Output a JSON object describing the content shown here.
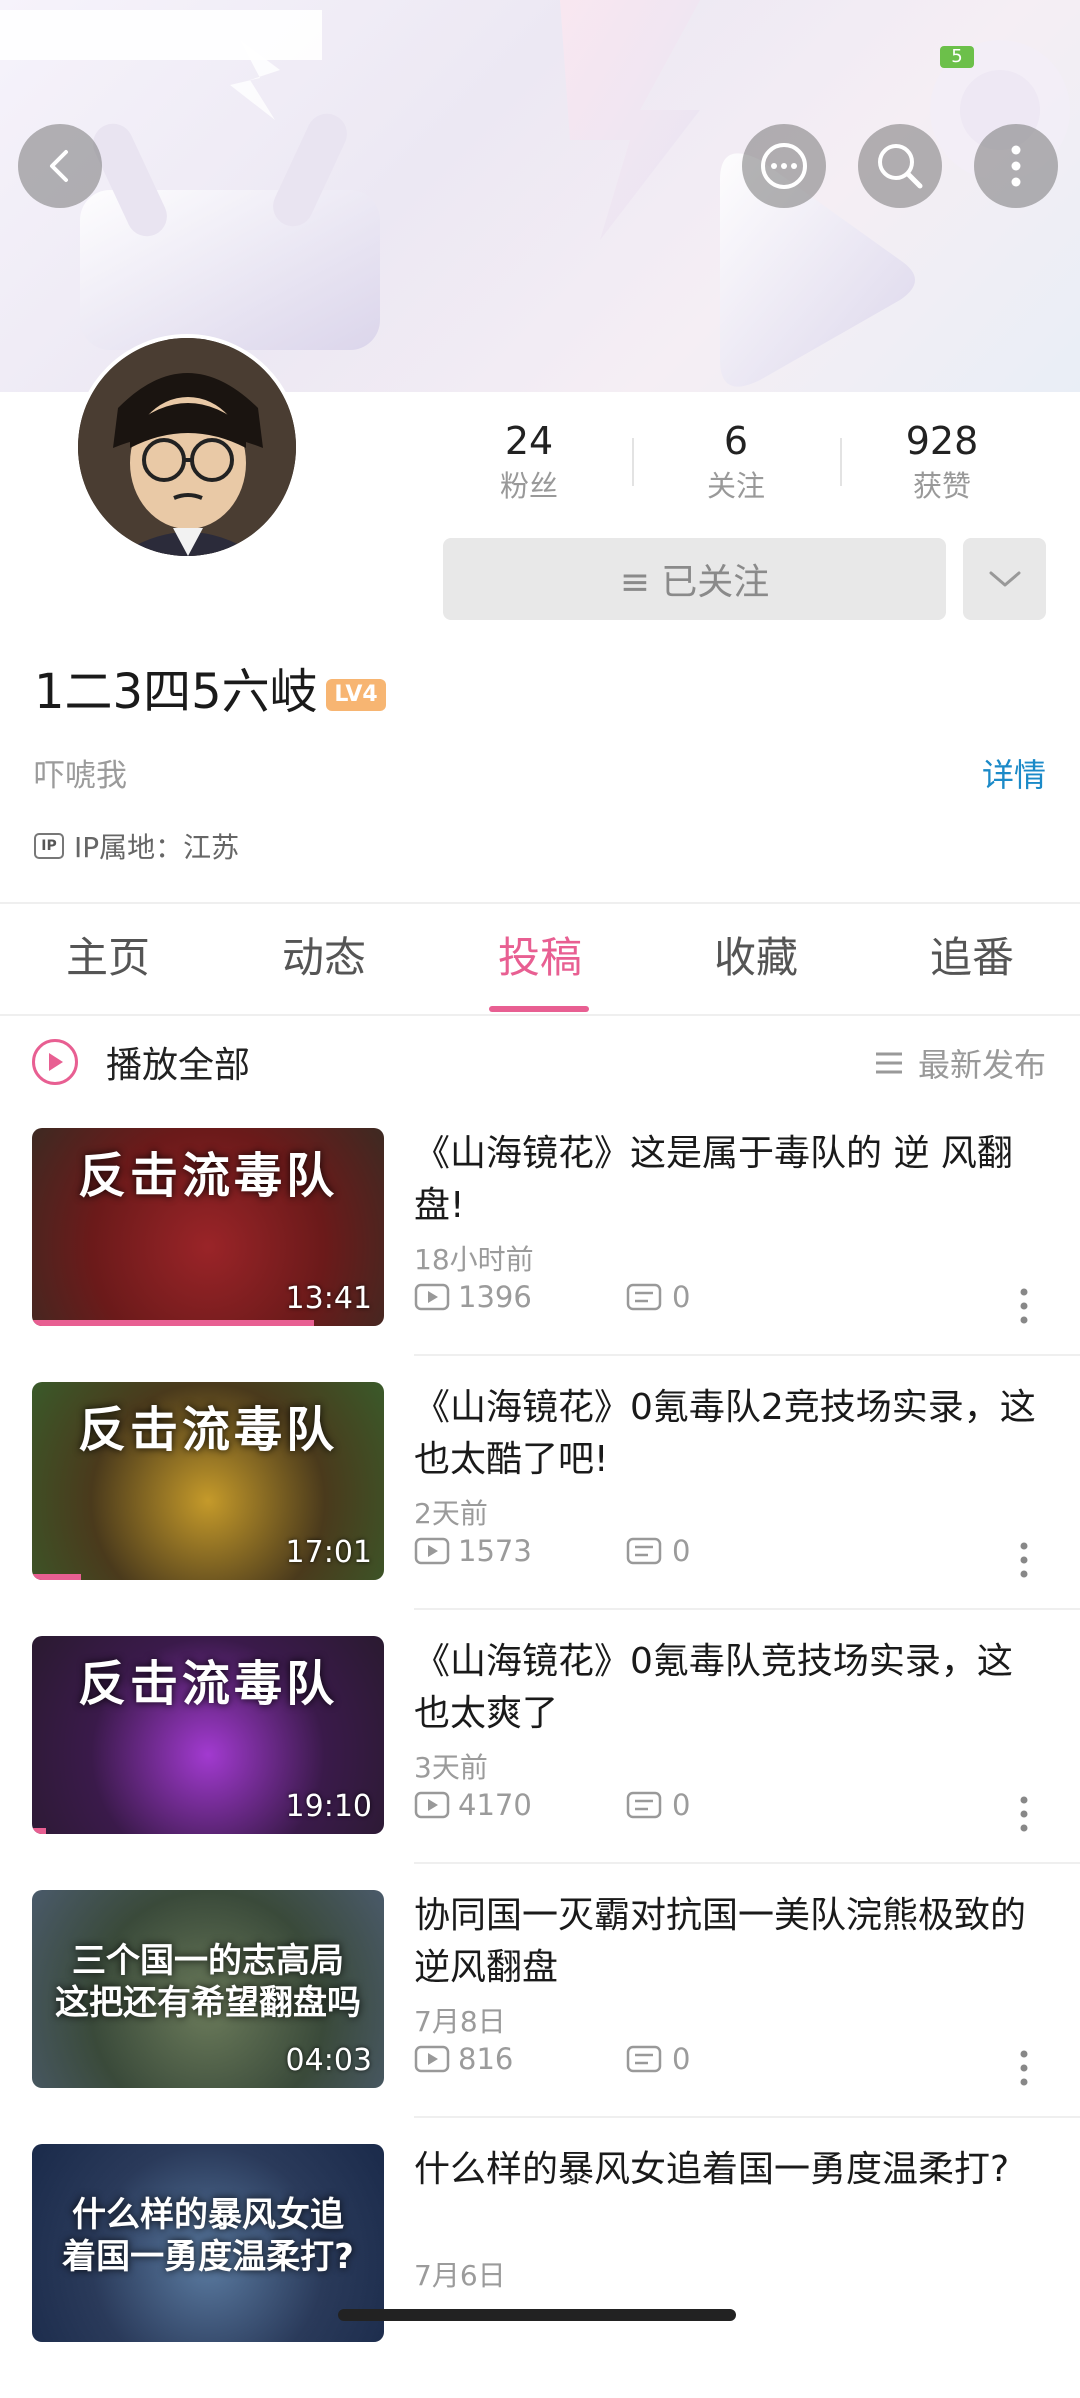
{
  "status_bar": {
    "battery": "5"
  },
  "profile": {
    "username": "1二3四5六岐",
    "level": "LV4",
    "signature": "吓唬我",
    "detail_link": "详情",
    "ip_location": "IP属地：江苏",
    "ip_icon_text": "IP",
    "stats": [
      {
        "value": "24",
        "label": "粉丝"
      },
      {
        "value": "6",
        "label": "关注"
      },
      {
        "value": "928",
        "label": "获赞"
      }
    ],
    "follow_button": "≡ 已关注"
  },
  "tabs": [
    {
      "label": "主页",
      "active": false
    },
    {
      "label": "动态",
      "active": false
    },
    {
      "label": "投稿",
      "active": true
    },
    {
      "label": "收藏",
      "active": false
    },
    {
      "label": "追番",
      "active": false
    }
  ],
  "list_header": {
    "play_all": "播放全部",
    "sort": "最新发布"
  },
  "videos": [
    {
      "title": "《山海镜花》这是属于毒队的 逆 风翻 盘!",
      "time": "18小时前",
      "views": "1396",
      "comments": "0",
      "duration": "13:41",
      "overlay": "反击流毒队",
      "progress": 0.8,
      "thumb_colors": [
        "#6b1a1a",
        "#9a2428",
        "#3d2a22"
      ]
    },
    {
      "title": "《山海镜花》0氪毒队2竞技场实录，这也太酷了吧!",
      "time": "2天前",
      "views": "1573",
      "comments": "0",
      "duration": "17:01",
      "overlay": "反击流毒队",
      "progress": 0.14,
      "thumb_colors": [
        "#4a3a1c",
        "#c59a2a",
        "#3a5a2a"
      ]
    },
    {
      "title": "《山海镜花》0氪毒队竞技场实录，这也太爽了",
      "time": "3天前",
      "views": "4170",
      "comments": "0",
      "duration": "19:10",
      "overlay": "反击流毒队",
      "progress": 0.04,
      "thumb_colors": [
        "#3a1a4a",
        "#a23ad0",
        "#2a1a30"
      ]
    },
    {
      "title": "协同国一灭霸对抗国一美队浣熊极致的逆风翻盘",
      "time": "7月8日",
      "views": "816",
      "comments": "0",
      "duration": "04:03",
      "overlay": "三个国一的志高局\n这把还有希望翻盘吗",
      "progress": 0,
      "thumb_colors": [
        "#3a4a3a",
        "#6a7a5a",
        "#4a5a6a"
      ]
    },
    {
      "title": "什么样的暴风女追着国一勇度温柔打?",
      "time": "7月6日",
      "views": "",
      "comments": "",
      "duration": "",
      "overlay": "什么样的暴风女追\n着国一勇度温柔打?",
      "progress": 0,
      "thumb_colors": [
        "#2a3a5a",
        "#5a7aa0",
        "#1a2a4a"
      ]
    }
  ]
}
